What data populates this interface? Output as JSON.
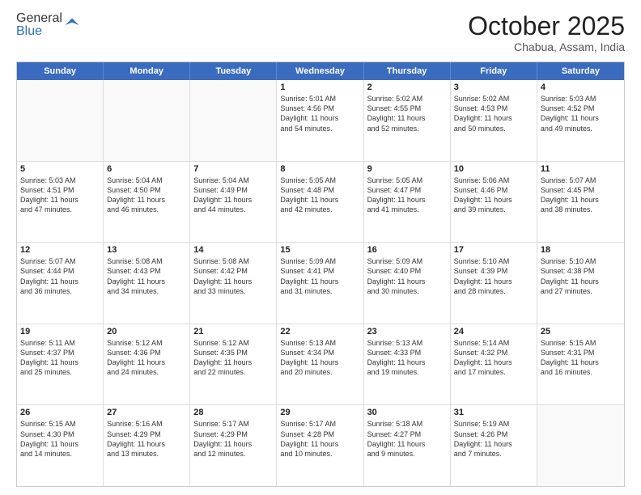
{
  "header": {
    "logo_general": "General",
    "logo_blue": "Blue",
    "title": "October 2025",
    "location": "Chabua, Assam, India"
  },
  "days_of_week": [
    "Sunday",
    "Monday",
    "Tuesday",
    "Wednesday",
    "Thursday",
    "Friday",
    "Saturday"
  ],
  "weeks": [
    [
      {
        "day": "",
        "info": ""
      },
      {
        "day": "",
        "info": ""
      },
      {
        "day": "",
        "info": ""
      },
      {
        "day": "1",
        "info": "Sunrise: 5:01 AM\nSunset: 4:56 PM\nDaylight: 11 hours\nand 54 minutes."
      },
      {
        "day": "2",
        "info": "Sunrise: 5:02 AM\nSunset: 4:55 PM\nDaylight: 11 hours\nand 52 minutes."
      },
      {
        "day": "3",
        "info": "Sunrise: 5:02 AM\nSunset: 4:53 PM\nDaylight: 11 hours\nand 50 minutes."
      },
      {
        "day": "4",
        "info": "Sunrise: 5:03 AM\nSunset: 4:52 PM\nDaylight: 11 hours\nand 49 minutes."
      }
    ],
    [
      {
        "day": "5",
        "info": "Sunrise: 5:03 AM\nSunset: 4:51 PM\nDaylight: 11 hours\nand 47 minutes."
      },
      {
        "day": "6",
        "info": "Sunrise: 5:04 AM\nSunset: 4:50 PM\nDaylight: 11 hours\nand 46 minutes."
      },
      {
        "day": "7",
        "info": "Sunrise: 5:04 AM\nSunset: 4:49 PM\nDaylight: 11 hours\nand 44 minutes."
      },
      {
        "day": "8",
        "info": "Sunrise: 5:05 AM\nSunset: 4:48 PM\nDaylight: 11 hours\nand 42 minutes."
      },
      {
        "day": "9",
        "info": "Sunrise: 5:05 AM\nSunset: 4:47 PM\nDaylight: 11 hours\nand 41 minutes."
      },
      {
        "day": "10",
        "info": "Sunrise: 5:06 AM\nSunset: 4:46 PM\nDaylight: 11 hours\nand 39 minutes."
      },
      {
        "day": "11",
        "info": "Sunrise: 5:07 AM\nSunset: 4:45 PM\nDaylight: 11 hours\nand 38 minutes."
      }
    ],
    [
      {
        "day": "12",
        "info": "Sunrise: 5:07 AM\nSunset: 4:44 PM\nDaylight: 11 hours\nand 36 minutes."
      },
      {
        "day": "13",
        "info": "Sunrise: 5:08 AM\nSunset: 4:43 PM\nDaylight: 11 hours\nand 34 minutes."
      },
      {
        "day": "14",
        "info": "Sunrise: 5:08 AM\nSunset: 4:42 PM\nDaylight: 11 hours\nand 33 minutes."
      },
      {
        "day": "15",
        "info": "Sunrise: 5:09 AM\nSunset: 4:41 PM\nDaylight: 11 hours\nand 31 minutes."
      },
      {
        "day": "16",
        "info": "Sunrise: 5:09 AM\nSunset: 4:40 PM\nDaylight: 11 hours\nand 30 minutes."
      },
      {
        "day": "17",
        "info": "Sunrise: 5:10 AM\nSunset: 4:39 PM\nDaylight: 11 hours\nand 28 minutes."
      },
      {
        "day": "18",
        "info": "Sunrise: 5:10 AM\nSunset: 4:38 PM\nDaylight: 11 hours\nand 27 minutes."
      }
    ],
    [
      {
        "day": "19",
        "info": "Sunrise: 5:11 AM\nSunset: 4:37 PM\nDaylight: 11 hours\nand 25 minutes."
      },
      {
        "day": "20",
        "info": "Sunrise: 5:12 AM\nSunset: 4:36 PM\nDaylight: 11 hours\nand 24 minutes."
      },
      {
        "day": "21",
        "info": "Sunrise: 5:12 AM\nSunset: 4:35 PM\nDaylight: 11 hours\nand 22 minutes."
      },
      {
        "day": "22",
        "info": "Sunrise: 5:13 AM\nSunset: 4:34 PM\nDaylight: 11 hours\nand 20 minutes."
      },
      {
        "day": "23",
        "info": "Sunrise: 5:13 AM\nSunset: 4:33 PM\nDaylight: 11 hours\nand 19 minutes."
      },
      {
        "day": "24",
        "info": "Sunrise: 5:14 AM\nSunset: 4:32 PM\nDaylight: 11 hours\nand 17 minutes."
      },
      {
        "day": "25",
        "info": "Sunrise: 5:15 AM\nSunset: 4:31 PM\nDaylight: 11 hours\nand 16 minutes."
      }
    ],
    [
      {
        "day": "26",
        "info": "Sunrise: 5:15 AM\nSunset: 4:30 PM\nDaylight: 11 hours\nand 14 minutes."
      },
      {
        "day": "27",
        "info": "Sunrise: 5:16 AM\nSunset: 4:29 PM\nDaylight: 11 hours\nand 13 minutes."
      },
      {
        "day": "28",
        "info": "Sunrise: 5:17 AM\nSunset: 4:29 PM\nDaylight: 11 hours\nand 12 minutes."
      },
      {
        "day": "29",
        "info": "Sunrise: 5:17 AM\nSunset: 4:28 PM\nDaylight: 11 hours\nand 10 minutes."
      },
      {
        "day": "30",
        "info": "Sunrise: 5:18 AM\nSunset: 4:27 PM\nDaylight: 11 hours\nand 9 minutes."
      },
      {
        "day": "31",
        "info": "Sunrise: 5:19 AM\nSunset: 4:26 PM\nDaylight: 11 hours\nand 7 minutes."
      },
      {
        "day": "",
        "info": ""
      }
    ]
  ]
}
